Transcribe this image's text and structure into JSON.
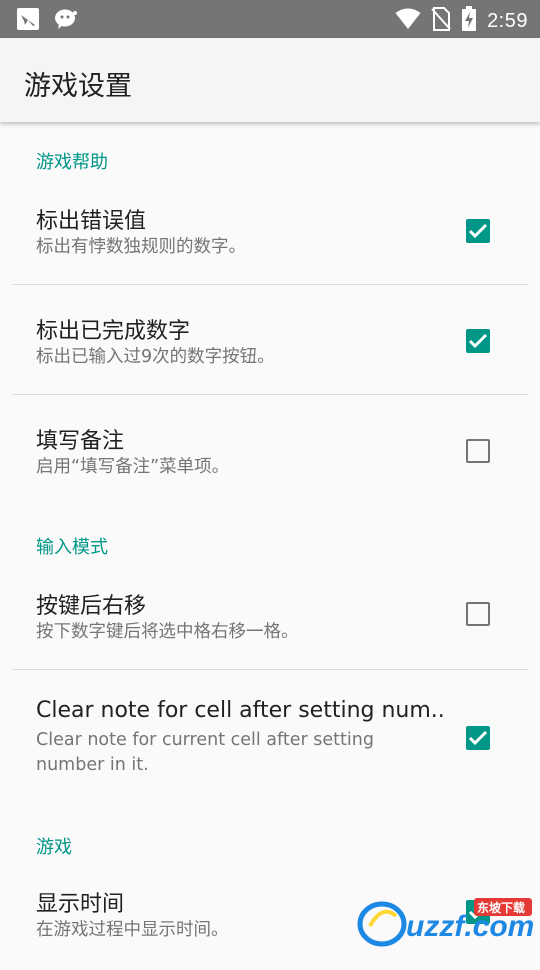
{
  "status_bar": {
    "time": "2:59",
    "icons": [
      "notification-icon",
      "wechat-icon",
      "wifi-icon",
      "no-sim-icon",
      "battery-charging-icon"
    ]
  },
  "app_bar": {
    "title": "游戏设置"
  },
  "categories": {
    "game_help": "游戏帮助",
    "input_mode": "输入模式",
    "game": "游戏"
  },
  "prefs": {
    "mark_errors": {
      "title": "标出错误值",
      "summary": "标出有悖数独规则的数字。",
      "checked": true
    },
    "mark_completed": {
      "title": "标出已完成数字",
      "summary": "标出已输入过9次的数字按钮。",
      "checked": true
    },
    "fill_notes": {
      "title": "填写备注",
      "summary": "启用“填写备注”菜单项。",
      "checked": false
    },
    "move_right": {
      "title": "按键后右移",
      "summary": "按下数字键后将选中格右移一格。",
      "checked": false
    },
    "clear_note": {
      "title": "Clear note for cell after setting num..",
      "summary": "Clear note for current cell after setting number in it.",
      "checked": true
    },
    "show_time": {
      "title": "显示时间",
      "summary": "在游戏过程中显示时间。",
      "checked": true
    }
  },
  "watermark": {
    "text_main": "uzzf.com",
    "text_badge": "东坡下载"
  },
  "colors": {
    "accent": "#009688",
    "status_bar": "#757575",
    "app_bar": "#f5f5f5",
    "background": "#fafafa"
  }
}
